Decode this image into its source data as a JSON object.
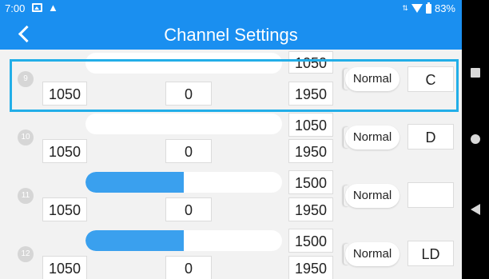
{
  "status": {
    "time": "7:00",
    "battery": "83%"
  },
  "header": {
    "title": "Channel Settings"
  },
  "channels": [
    {
      "number": "9",
      "min": "1050",
      "center": "0",
      "upper": "1050",
      "max": "1950",
      "mode": "Normal",
      "switch": "C",
      "fill": 0
    },
    {
      "number": "10",
      "min": "1050",
      "center": "0",
      "upper": "1050",
      "max": "1950",
      "mode": "Normal",
      "switch": "D",
      "fill": 0
    },
    {
      "number": "11",
      "min": "1050",
      "center": "0",
      "upper": "1500",
      "max": "1950",
      "mode": "Normal",
      "switch": "",
      "fill": 0.5
    },
    {
      "number": "12",
      "min": "1050",
      "center": "0",
      "upper": "1500",
      "max": "1950",
      "mode": "Normal",
      "switch": "LD",
      "fill": 0.5
    }
  ]
}
